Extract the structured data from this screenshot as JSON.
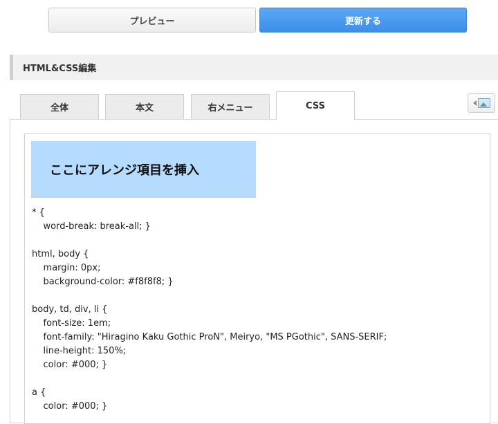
{
  "toolbar": {
    "preview_label": "プレビュー",
    "update_label": "更新する"
  },
  "section": {
    "title": "HTML&CSS編集"
  },
  "tabs": [
    {
      "label": "全体",
      "active": false
    },
    {
      "label": "本文",
      "active": false
    },
    {
      "label": "右メニュー",
      "active": false
    },
    {
      "label": "CSS",
      "active": true
    }
  ],
  "media_button": {
    "icon": "insert-image-icon"
  },
  "editor": {
    "banner_text": "ここにアレンジ項目を挿入",
    "code_lines": [
      "* {",
      "    word-break: break-all; }",
      "",
      "html, body {",
      "    margin: 0px;",
      "    background-color: #f8f8f8; }",
      "",
      "body, td, div, li {",
      "    font-size: 1em;",
      "    font-family: \"Hiragino Kaku Gothic ProN\", Meiryo, \"MS PGothic\", SANS-SERIF;",
      "    line-height: 150%;",
      "    color: #000; }",
      "",
      "a {",
      "    color: #000; }"
    ]
  },
  "colors": {
    "accent": "#3b8ee9",
    "banner": "#b5dcff"
  }
}
